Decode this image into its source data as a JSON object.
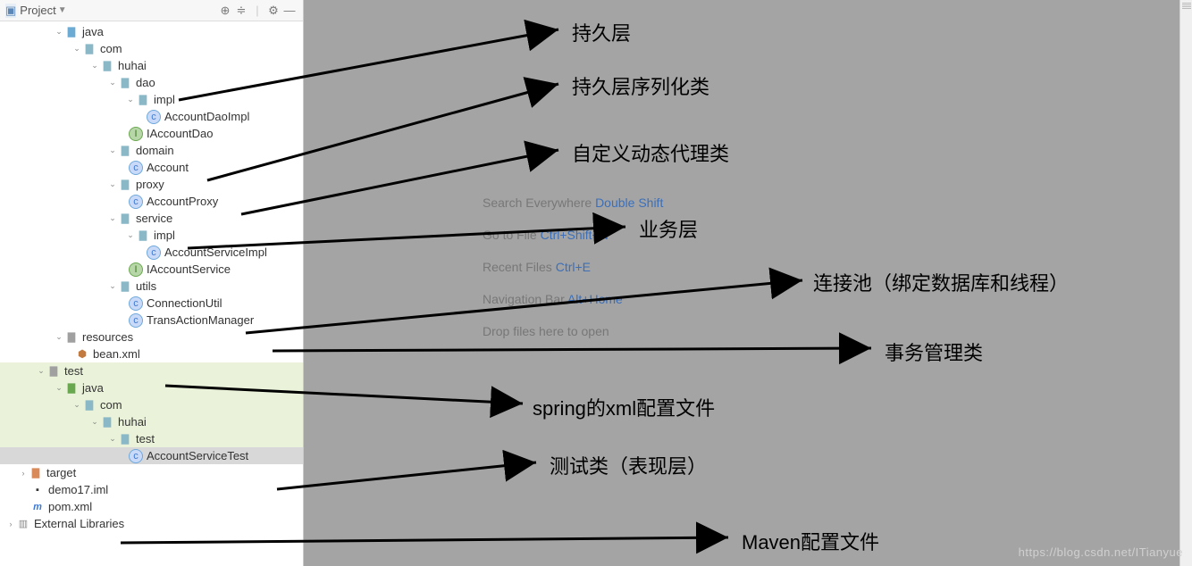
{
  "titlebar": {
    "label": "Project"
  },
  "tree": {
    "java": "java",
    "com": "com",
    "huhai": "huhai",
    "dao": "dao",
    "impl1": "impl",
    "accountDaoImpl": "AccountDaoImpl",
    "iAccountDao": "IAccountDao",
    "domain": "domain",
    "account": "Account",
    "proxy": "proxy",
    "accountProxy": "AccountProxy",
    "service": "service",
    "impl2": "impl",
    "accountServiceImpl": "AccountServiceImpl",
    "iAccountService": "IAccountService",
    "utils": "utils",
    "connectionUtil": "ConnectionUtil",
    "transActionManager": "TransActionManager",
    "resources": "resources",
    "beanXml": "bean.xml",
    "test": "test",
    "tjava": "java",
    "tcom": "com",
    "thuhai": "huhai",
    "ttest": "test",
    "accountServiceTest": "AccountServiceTest",
    "target": "target",
    "demoIml": "demo17.iml",
    "pomXml": "pom.xml",
    "externalLibs": "External Libraries"
  },
  "hints": {
    "l1a": "Search Everywhere ",
    "l1b": "Double Shift",
    "l2a": "Go to File ",
    "l2b": "Ctrl+Shift+N",
    "l3a": "Recent Files ",
    "l3b": "Ctrl+E",
    "l4a": "Navigation Bar ",
    "l4b": "Alt+Home",
    "l5": "Drop files here to open"
  },
  "annotations": {
    "a1": "持久层",
    "a2": "持久层序列化类",
    "a3": "自定义动态代理类",
    "a4": "业务层",
    "a5": "连接池（绑定数据库和线程）",
    "a6": "事务管理类",
    "a7": "spring的xml配置文件",
    "a8": "测试类（表现层）",
    "a9": "Maven配置文件"
  },
  "watermark": "https://blog.csdn.net/ITianyue"
}
